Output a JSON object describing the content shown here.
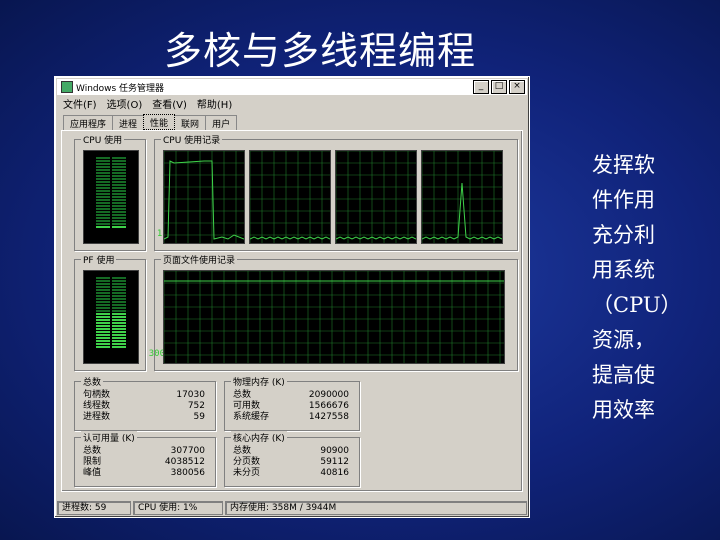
{
  "slide": {
    "title": "多核与多线程编程",
    "side_lines": [
      "发挥软",
      "件作用",
      "充分利",
      "用系统",
      "（CPU）",
      "资源，",
      "提高使",
      "用效率"
    ]
  },
  "window": {
    "title": "Windows 任务管理器",
    "controls": [
      "_",
      "□",
      "×"
    ],
    "menu": [
      "文件(F)",
      "选项(O)",
      "查看(V)",
      "帮助(H)"
    ],
    "tabs": [
      "应用程序",
      "进程",
      "性能",
      "联网",
      "用户"
    ],
    "active_tab": 2
  },
  "performance": {
    "cpu_usage": {
      "label": "CPU 使用",
      "value": "1 %"
    },
    "cpu_history": {
      "label": "CPU 使用记录",
      "cores": 4
    },
    "pf_usage": {
      "label": "PF 使用",
      "value": "300 MB"
    },
    "pf_history": {
      "label": "页面文件使用记录"
    },
    "totals": {
      "label": "总数",
      "rows": [
        [
          "句柄数",
          "17030"
        ],
        [
          "线程数",
          "752"
        ],
        [
          "进程数",
          "59"
        ]
      ]
    },
    "physical_memory": {
      "label": "物理内存 (K)",
      "rows": [
        [
          "总数",
          "2090000"
        ],
        [
          "可用数",
          "1566676"
        ],
        [
          "系统缓存",
          "1427558"
        ]
      ]
    },
    "commit_charge": {
      "label": "认可用量 (K)",
      "rows": [
        [
          "总数",
          "307700"
        ],
        [
          "限制",
          "4038512"
        ],
        [
          "峰值",
          "380056"
        ]
      ]
    },
    "kernel_memory": {
      "label": "核心内存 (K)",
      "rows": [
        [
          "总数",
          "90900"
        ],
        [
          "分页数",
          "59112"
        ],
        [
          "未分页",
          "40816"
        ]
      ]
    }
  },
  "status": {
    "processes": "进程数: 59",
    "cpu": "CPU 使用: 1%",
    "commit": "内存使用: 358M / 3944M"
  },
  "colors": {
    "graph_line": "#3fd24a",
    "grid": "#1f7a2a",
    "background": "#10237a"
  }
}
